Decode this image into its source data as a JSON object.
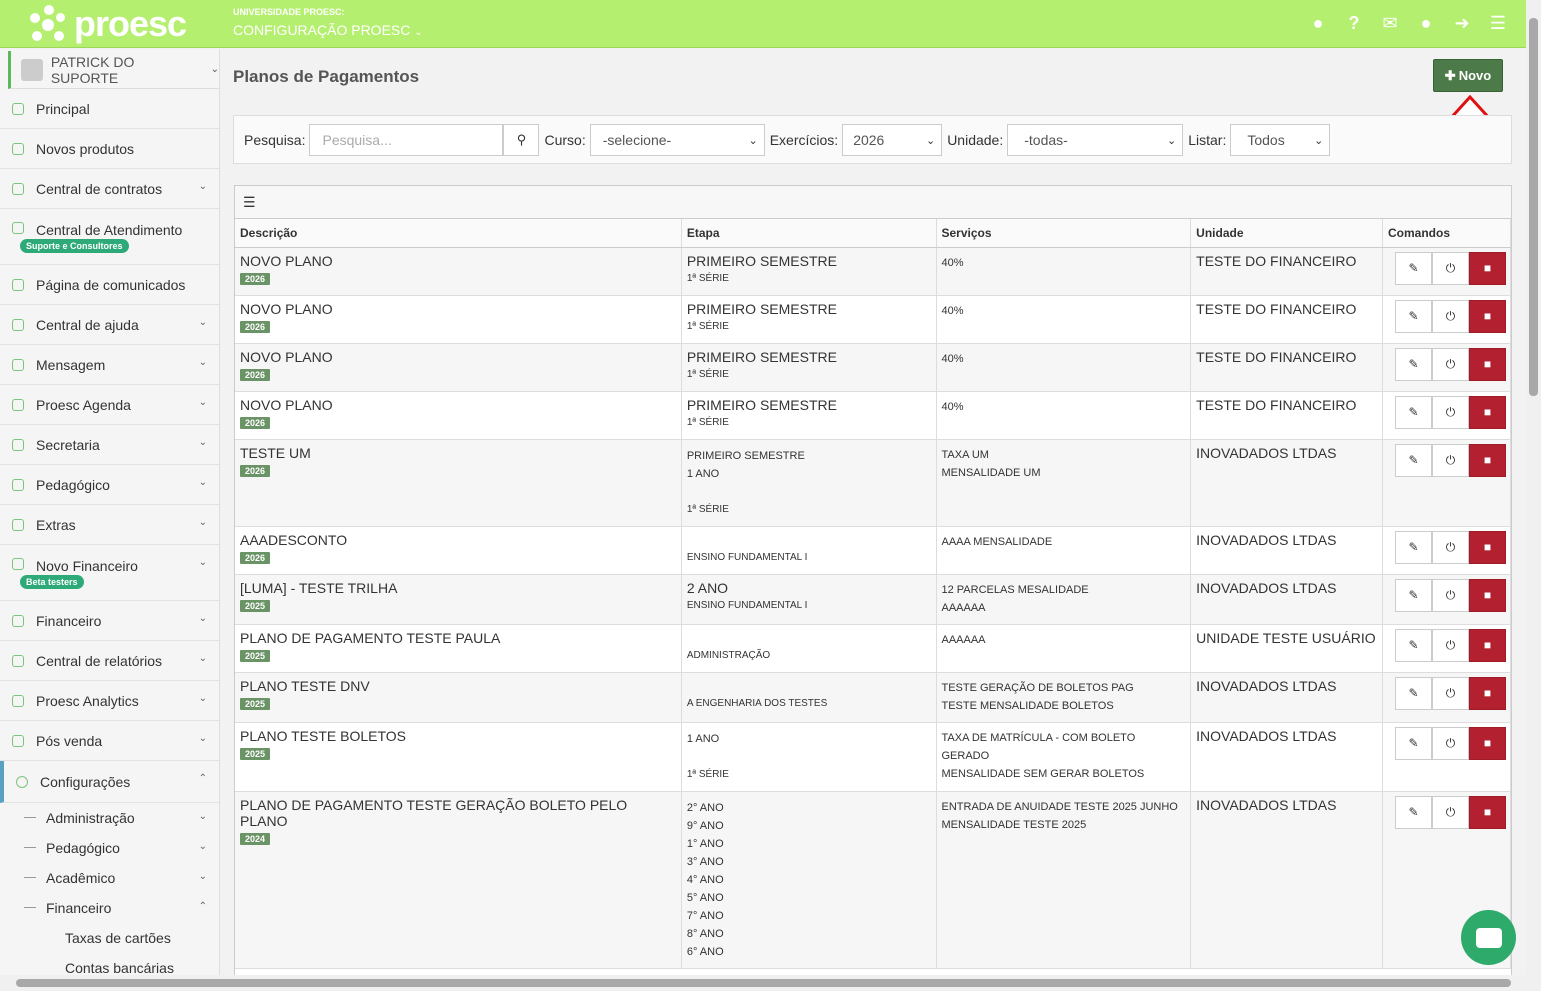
{
  "app": {
    "logo_text": "proesc",
    "university": "UNIVERSIDADE PROESC:",
    "config_label": "CONFIGURAÇÃO PROESC"
  },
  "topbar_icons": [
    "handshake-icon",
    "help-icon",
    "envelope-icon",
    "user-icon",
    "logout-icon",
    "menu-icon"
  ],
  "sidebar": {
    "user": "PATRICK DO SUPORTE",
    "items": [
      {
        "label": "Principal",
        "icon": "home-icon",
        "chev": false
      },
      {
        "label": "Novos produtos",
        "icon": "star-icon",
        "chev": false
      },
      {
        "label": "Central de contratos",
        "icon": "file-icon",
        "chev": true
      },
      {
        "label": "Central de Atendimento",
        "icon": "headset-icon",
        "chev": false,
        "badge": "Suporte e Consultores"
      },
      {
        "label": "Página de comunicados",
        "icon": "megaphone-icon",
        "chev": false
      },
      {
        "label": "Central de ajuda",
        "icon": "info-icon",
        "chev": true
      },
      {
        "label": "Mensagem",
        "icon": "envelope-icon",
        "chev": true
      },
      {
        "label": "Proesc Agenda",
        "icon": "calendar-icon",
        "chev": true
      },
      {
        "label": "Secretaria",
        "icon": "users-icon",
        "chev": true
      },
      {
        "label": "Pedagógico",
        "icon": "graduation-icon",
        "chev": true
      },
      {
        "label": "Extras",
        "icon": "plus-icon",
        "chev": true
      },
      {
        "label": "Novo Financeiro",
        "icon": "dollar-icon",
        "chev": true,
        "badge": "Beta testers"
      },
      {
        "label": "Financeiro",
        "icon": "dollar-icon",
        "chev": true
      },
      {
        "label": "Central de relatórios",
        "icon": "chart-icon",
        "chev": true
      },
      {
        "label": "Proesc Analytics",
        "icon": "database-icon",
        "chev": true
      },
      {
        "label": "Pós venda",
        "icon": "ticket-icon",
        "chev": true
      }
    ],
    "config": "Configurações",
    "config_sub": [
      "Administração",
      "Pedagógico",
      "Acadêmico",
      "Financeiro"
    ],
    "fin_sub": [
      "Taxas de cartões",
      "Contas bancárias"
    ]
  },
  "page": {
    "title": "Planos de Pagamentos",
    "new_button": "Novo"
  },
  "filters": {
    "search_label": "Pesquisa:",
    "search_placeholder": "Pesquisa...",
    "curso_label": "Curso:",
    "curso_value": "-selecione-",
    "exercicios_label": "Exercícios:",
    "exercicios_value": "2026",
    "unidade_label": "Unidade:",
    "unidade_value": "-todas-",
    "listar_label": "Listar:",
    "listar_value": "Todos"
  },
  "table": {
    "headers": [
      "Descrição",
      "Etapa",
      "Serviços",
      "Unidade",
      "Comandos"
    ],
    "rows": [
      {
        "desc": "NOVO PLANO",
        "year": "2026",
        "etapa_main": "PRIMEIRO SEMESTRE",
        "etapa_lines": [
          "1ª SÉRIE"
        ],
        "servicos": [
          "40%"
        ],
        "unidade": "TESTE DO FINANCEIRO"
      },
      {
        "desc": "NOVO PLANO",
        "year": "2026",
        "etapa_main": "PRIMEIRO SEMESTRE",
        "etapa_lines": [
          "1ª SÉRIE"
        ],
        "servicos": [
          "40%"
        ],
        "unidade": "TESTE DO FINANCEIRO"
      },
      {
        "desc": "NOVO PLANO",
        "year": "2026",
        "etapa_main": "PRIMEIRO SEMESTRE",
        "etapa_lines": [
          "1ª SÉRIE"
        ],
        "servicos": [
          "40%"
        ],
        "unidade": "TESTE DO FINANCEIRO"
      },
      {
        "desc": "NOVO PLANO",
        "year": "2026",
        "etapa_main": "PRIMEIRO SEMESTRE",
        "etapa_lines": [
          "1ª SÉRIE"
        ],
        "servicos": [
          "40%"
        ],
        "unidade": "TESTE DO FINANCEIRO"
      },
      {
        "desc": "TESTE UM",
        "year": "2026",
        "etapa_main": "",
        "etapa_lines_c": [
          "PRIMEIRO SEMESTRE",
          "1 ANO",
          ""
        ],
        "etapa_lines": [
          "1ª SÉRIE"
        ],
        "servicos": [
          "TAXA UM",
          "MENSALIDADE UM"
        ],
        "unidade": "INOVADADOS LTDAS"
      },
      {
        "desc": "AAADESCONTO",
        "year": "2026",
        "etapa_main": "",
        "etapa_lines": [
          "ENSINO FUNDAMENTAL I"
        ],
        "servicos": [
          "AAAA MENSALIDADE"
        ],
        "unidade": "INOVADADOS LTDAS"
      },
      {
        "desc": "[LUMA] - TESTE TRILHA",
        "year": "2025",
        "etapa_main": "2 ANO",
        "etapa_lines": [
          "ENSINO FUNDAMENTAL I"
        ],
        "servicos": [
          "12 PARCELAS MESALIDADE",
          "AAAAAA"
        ],
        "unidade": "INOVADADOS LTDAS"
      },
      {
        "desc": "PLANO DE PAGAMENTO TESTE PAULA",
        "year": "2025",
        "etapa_main": "",
        "etapa_lines": [
          "ADMINISTRAÇÃO"
        ],
        "servicos": [
          "AAAAAA"
        ],
        "unidade": "UNIDADE TESTE USUÁRIO"
      },
      {
        "desc": "PLANO TESTE DNV",
        "year": "2025",
        "etapa_main": "",
        "etapa_lines": [
          "A ENGENHARIA DOS TESTES"
        ],
        "servicos": [
          "TESTE GERAÇÃO DE BOLETOS PAG",
          "TESTE MENSALIDADE BOLETOS"
        ],
        "unidade": "INOVADADOS LTDAS"
      },
      {
        "desc": "PLANO TESTE BOLETOS",
        "year": "2025",
        "etapa_main": "",
        "etapa_lines_c": [
          "1 ANO",
          ""
        ],
        "etapa_lines": [
          "1ª SÉRIE"
        ],
        "servicos": [
          "TAXA DE MATRÍCULA - COM BOLETO GERADO",
          "MENSALIDADE SEM GERAR BOLETOS"
        ],
        "unidade": "INOVADADOS LTDAS"
      },
      {
        "desc": "PLANO DE PAGAMENTO TESTE GERAÇÃO BOLETO PELO PLANO",
        "year": "2024",
        "etapa_main": "",
        "etapa_lines_c": [
          "2° ANO",
          "9° ANO",
          "1° ANO",
          "3° ANO",
          "4° ANO",
          "5° ANO",
          "7° ANO",
          "8° ANO",
          "6° ANO"
        ],
        "etapa_lines": [],
        "servicos": [
          "ENTRADA DE ANUIDADE TESTE 2025 JUNHO",
          "MENSALIDADE TESTE 2025"
        ],
        "unidade": "INOVADADOS LTDAS"
      }
    ]
  }
}
